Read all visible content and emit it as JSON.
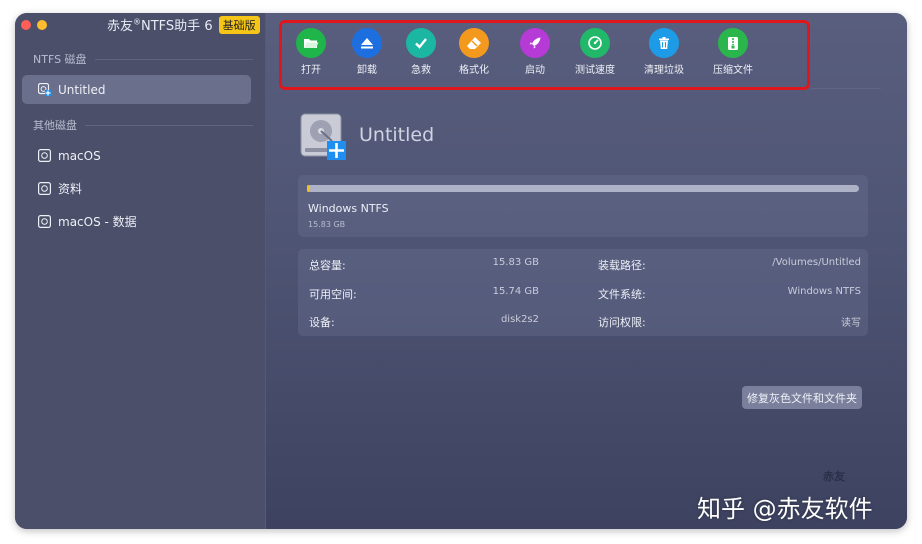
{
  "app": {
    "title": "赤友",
    "title_sup": "®",
    "title_rest": "NTFS助手 6",
    "edition_badge": "基础版"
  },
  "sidebar": {
    "ntfs_section": "NTFS 磁盘",
    "ntfs_items": [
      {
        "label": "Untitled",
        "icon": "ntfs-disk-icon",
        "active": true
      }
    ],
    "other_section": "其他磁盘",
    "other_items": [
      {
        "label": "macOS",
        "icon": "disk-icon"
      },
      {
        "label": "资料",
        "icon": "disk-icon"
      },
      {
        "label": "macOS - 数据",
        "icon": "disk-icon"
      }
    ]
  },
  "toolbar": [
    {
      "label": "打开",
      "icon": "folder-open-icon",
      "color": "#1fb54a"
    },
    {
      "label": "卸载",
      "icon": "eject-icon",
      "color": "#1d6fe0"
    },
    {
      "label": "急救",
      "icon": "checkmark-icon",
      "color": "#1bb7a3"
    },
    {
      "label": "格式化",
      "icon": "eraser-icon",
      "color": "#f39a1e"
    },
    {
      "label": "启动",
      "icon": "rocket-icon",
      "color": "#b53ad6"
    },
    {
      "label": "测试速度",
      "icon": "speedometer-icon",
      "color": "#21b86a"
    },
    {
      "label": "清理垃圾",
      "icon": "trash-icon",
      "color": "#1e9be6"
    },
    {
      "label": "压缩文件",
      "icon": "zip-file-icon",
      "color": "#2bb54d"
    }
  ],
  "disk": {
    "title": "Untitled",
    "volume_name": "Windows NTFS",
    "volume_size": "15.83 GB",
    "usage_fraction": 0.006
  },
  "info": {
    "total_label": "总容量:",
    "total_value": "15.83 GB",
    "mount_label": "装载路径:",
    "mount_value": "/Volumes/Untitled",
    "free_label": "可用空间:",
    "free_value": "15.74 GB",
    "fs_label": "文件系统:",
    "fs_value": "Windows NTFS",
    "device_label": "设备:",
    "device_value": "disk2s2",
    "access_label": "访问权限:",
    "access_value": "读写"
  },
  "repair_button": "修复灰色文件和文件夹",
  "watermark_small": "赤友",
  "watermark": "知乎 @赤友软件",
  "colors": {
    "accent_yellow": "#f2c21a",
    "highlight_red": "#e0161d"
  }
}
